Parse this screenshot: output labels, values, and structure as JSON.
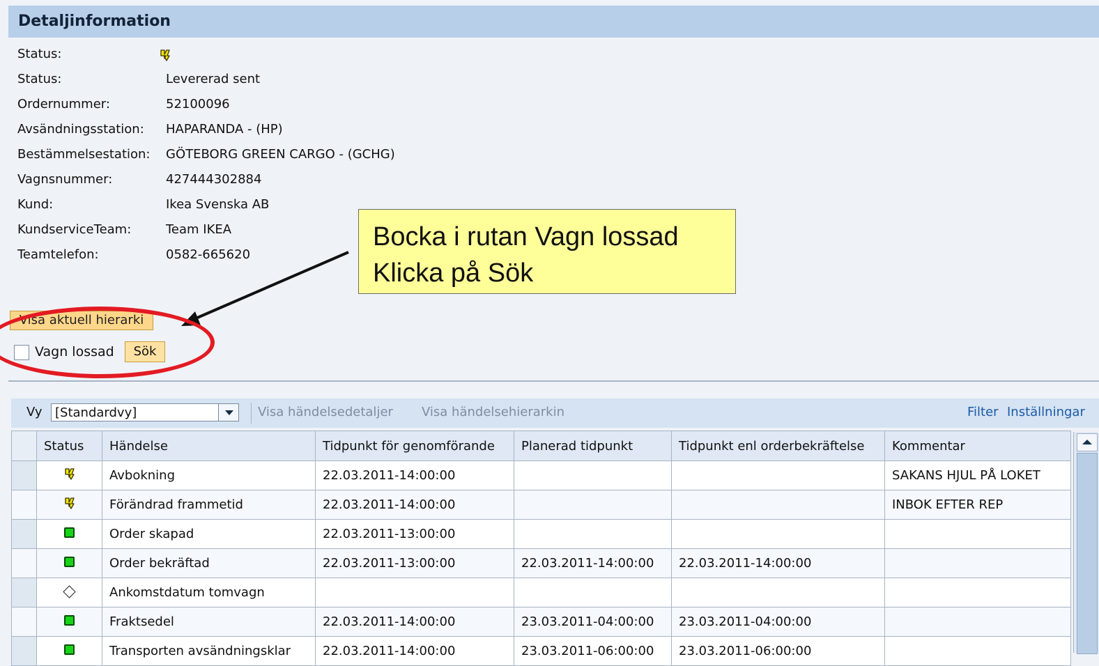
{
  "section": {
    "title": "Detaljinformation"
  },
  "details": [
    {
      "label": "Status:",
      "value": "",
      "icon": "yellow-status-icon"
    },
    {
      "label": "Status:",
      "value": "Levererad sent"
    },
    {
      "label": "Ordernummer:",
      "value": "52100096"
    },
    {
      "label": "Avsändningsstation:",
      "value": "HAPARANDA - (HP)"
    },
    {
      "label": "Bestämmelsestation:",
      "value": "GÖTEBORG GREEN CARGO - (GCHG)"
    },
    {
      "label": "Vagnsnummer:",
      "value": "427444302884"
    },
    {
      "label": "Kund:",
      "value": "Ikea Svenska AB"
    },
    {
      "label": "KundserviceTeam:",
      "value": "Team IKEA"
    },
    {
      "label": "Teamtelefon:",
      "value": "0582-665620"
    }
  ],
  "actions": {
    "show_hierarchy": "Visa aktuell hierarki",
    "wagon_unloaded_label": "Vagn lossad",
    "search": "Sök",
    "wagon_unloaded_checked": false
  },
  "callout": {
    "line1": "Bocka i rutan Vagn lossad",
    "line2": "Klicka på Sök"
  },
  "toolbar": {
    "view_label": "Vy",
    "selected_view": "[Standardvy]",
    "show_event_details": "Visa händelsedetaljer",
    "show_event_hierarchy": "Visa händelsehierarkin",
    "filter": "Filter",
    "settings": "Inställningar"
  },
  "table": {
    "headers": [
      "Status",
      "Händelse",
      "Tidpunkt för genomförande",
      "Planerad tidpunkt",
      "Tidpunkt enl orderbekräftelse",
      "Kommentar"
    ],
    "rows": [
      {
        "status": "yellow-status-icon",
        "event": "Avbokning",
        "executed": "22.03.2011-14:00:00",
        "planned": "",
        "confirmed": "",
        "comment": "SAKANS HJUL PÅ LOKET"
      },
      {
        "status": "yellow-status-icon",
        "event": "Förändrad frammetid",
        "executed": "22.03.2011-14:00:00",
        "planned": "",
        "confirmed": "",
        "comment": "INBOK EFTER REP"
      },
      {
        "status": "green-square-icon",
        "event": "Order skapad",
        "executed": "22.03.2011-13:00:00",
        "planned": "",
        "confirmed": "",
        "comment": ""
      },
      {
        "status": "green-square-icon",
        "event": "Order bekräftad",
        "executed": "22.03.2011-13:00:00",
        "planned": "22.03.2011-14:00:00",
        "confirmed": "22.03.2011-14:00:00",
        "comment": ""
      },
      {
        "status": "diamond-icon",
        "event": "Ankomstdatum tomvagn",
        "executed": "",
        "planned": "",
        "confirmed": "",
        "comment": ""
      },
      {
        "status": "green-square-icon",
        "event": "Fraktsedel",
        "executed": "22.03.2011-14:00:00",
        "planned": "23.03.2011-04:00:00",
        "confirmed": "23.03.2011-04:00:00",
        "comment": ""
      },
      {
        "status": "green-square-icon",
        "event": "Transporten avsändningsklar",
        "executed": "22.03.2011-14:00:00",
        "planned": "23.03.2011-06:00:00",
        "confirmed": "23.03.2011-06:00:00",
        "comment": ""
      }
    ]
  },
  "colors": {
    "header_band": "#b8cfea",
    "callout_fill": "#ffff99",
    "highlight_ring": "#e31b23",
    "status_green": "#18d418",
    "status_yellow": "#f4e600"
  }
}
